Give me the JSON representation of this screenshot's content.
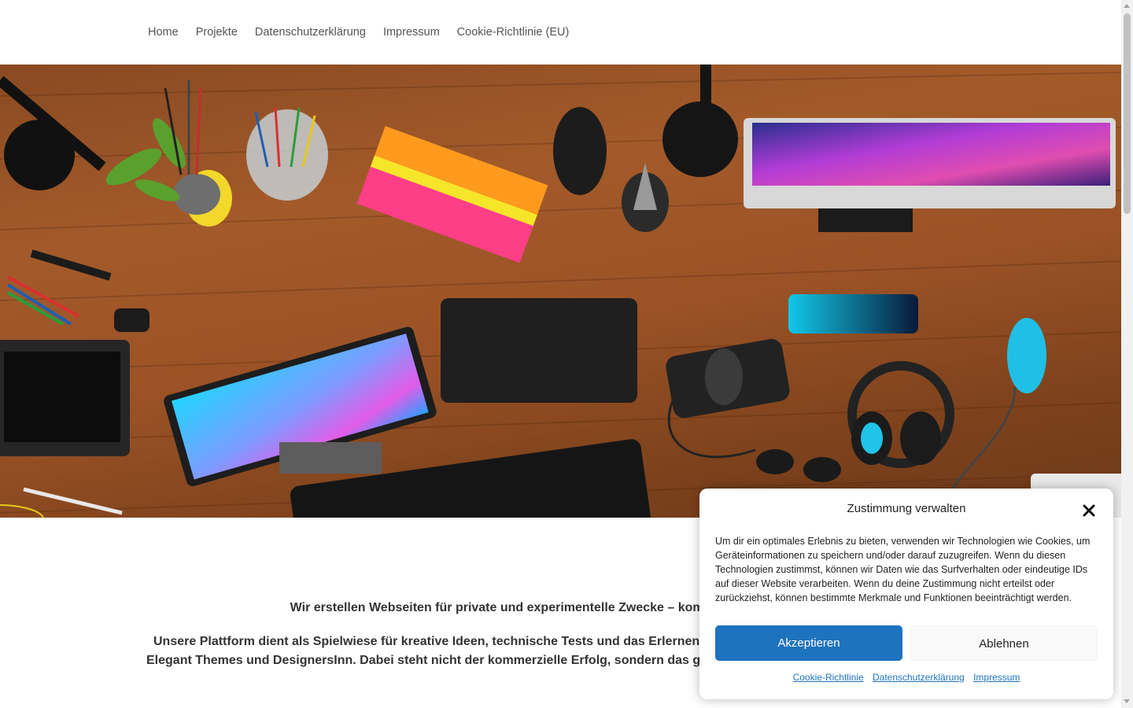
{
  "nav": {
    "items": [
      {
        "label": "Home"
      },
      {
        "label": "Projekte"
      },
      {
        "label": "Datenschutzerklärung"
      },
      {
        "label": "Impressum"
      },
      {
        "label": "Cookie-Richtlinie (EU)"
      }
    ]
  },
  "content": {
    "p1": "Wir erstellen Webseiten für private und experimentelle Zwecke – komplett non-profit und n",
    "p2_line1": "Unsere Plattform dient als Spielwiese für kreative Ideen, technische Tests und das Erlernen mode",
    "p2_line2": "Elegant Themes und DesignersInn. Dabei steht nicht der kommerzielle Erfolg, sondern das gemein"
  },
  "cookie": {
    "title": "Zustimmung verwalten",
    "text": "Um dir ein optimales Erlebnis zu bieten, verwenden wir Technologien wie Cookies, um Geräteinformationen zu speichern und/oder darauf zuzugreifen. Wenn du diesen Technologien zustimmst, können wir Daten wie das Surfverhalten oder eindeutige IDs auf dieser Website verarbeiten. Wenn du deine Zustimmung nicht erteilst oder zurückziehst, können bestimmte Merkmale und Funktionen beeinträchtigt werden.",
    "accept_label": "Akzeptieren",
    "deny_label": "Ablehnen",
    "links": [
      {
        "label": "Cookie-Richtlinie"
      },
      {
        "label": "Datenschutzerklärung"
      },
      {
        "label": "Impressum"
      }
    ]
  },
  "colors": {
    "accent": "#1e73be",
    "nav_text": "#555555",
    "body_text": "#333333"
  },
  "icons": {
    "close": "close-icon"
  }
}
